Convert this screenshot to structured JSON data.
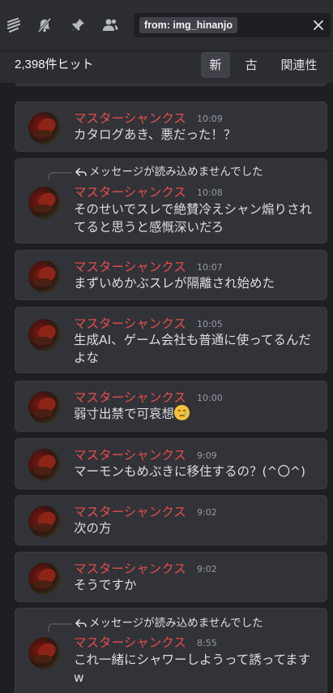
{
  "toolbar": {
    "icons": [
      "threads-icon",
      "mute-bell-icon",
      "pin-icon",
      "members-icon"
    ]
  },
  "search": {
    "filter_chip": "from: img_hinanjo"
  },
  "results_header": {
    "count_label": "2,398件ヒット",
    "sort_options": [
      {
        "label": "新",
        "active": true
      },
      {
        "label": "古",
        "active": false
      },
      {
        "label": "関連性",
        "active": false
      }
    ]
  },
  "messages": [
    {
      "author": "マスターシャンクス",
      "time": "10:09",
      "reply": "",
      "text": "カタログあき、悪だった！？"
    },
    {
      "author": "マスターシャンクス",
      "time": "10:08",
      "reply": "メッセージが読み込めませんでした",
      "text": "そのせいでスレで絶賛冷えシャン煽りされてると思うと感慨深いだろ"
    },
    {
      "author": "マスターシャンクス",
      "time": "10:07",
      "reply": "",
      "text": "まずいめかぶスレが隔離され始めた"
    },
    {
      "author": "マスターシャンクス",
      "time": "10:05",
      "reply": "",
      "text": "生成AI、ゲーム会社も普通に使ってるんだよな"
    },
    {
      "author": "マスターシャンクス",
      "time": "10:00",
      "reply": "",
      "text": "弱寸出禁で可哀想"
    },
    {
      "author": "マスターシャンクス",
      "time": "9:09",
      "reply": "",
      "text": "マーモンもめぶきに移住するの？(^〇^)"
    },
    {
      "author": "マスターシャンクス",
      "time": "9:02",
      "reply": "",
      "text": "次の方"
    },
    {
      "author": "マスターシャンクス",
      "time": "9:02",
      "reply": "",
      "text": "そうですか"
    },
    {
      "author": "マスターシャンクス",
      "time": "8:55",
      "reply": "メッセージが読み込めませんでした",
      "text": "これ一緒にシャワーしようって誘ってますw"
    }
  ],
  "colors": {
    "author": "#e74c4c",
    "background": "#1e1f22",
    "card": "#313338"
  }
}
